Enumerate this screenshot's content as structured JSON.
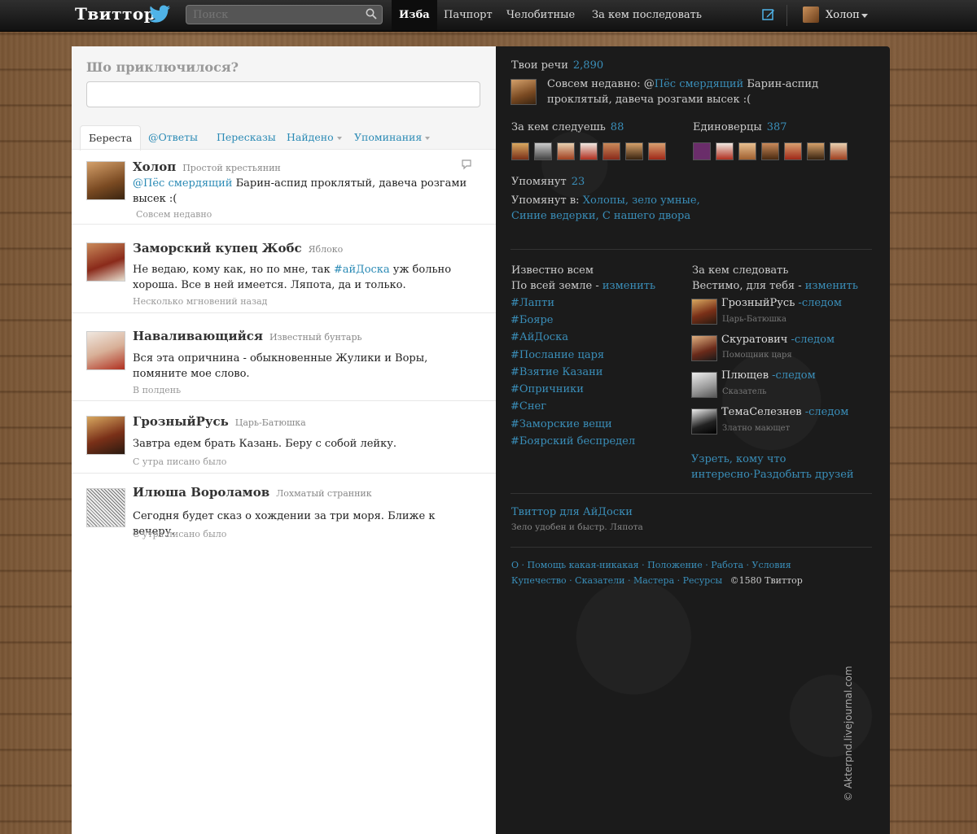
{
  "topbar": {
    "logo": "Твиттор",
    "search_placeholder": "Поиск",
    "nav": [
      "Изба",
      "Пачпорт",
      "Челобитные",
      "За кем последовать"
    ],
    "user": "Холоп"
  },
  "compose": {
    "title": "Шо приключилося?"
  },
  "tabs": [
    "Береста",
    "@Ответы",
    "Пересказы",
    "Найдено",
    "Упоминания"
  ],
  "tweets": [
    {
      "name": "Холоп",
      "handle": "Простой крестьянин",
      "mention": "@Пёс смердящий",
      "text": " Барин-аспид проклятый, давеча розгами высек :(",
      "time": "Совсем недавно"
    },
    {
      "name": "Заморский купец Жобс",
      "handle": "Яблоко",
      "text_before": "Не ведаю, кому как, но по мне, так ",
      "hashtag": "#айДоска",
      "text_after": " уж больно хороша. Все в ней имеется. Ляпота, да и только.",
      "time": "Несколько мгновений назад"
    },
    {
      "name": "Наваливающийся",
      "handle": "Известный бунтарь",
      "text": "Вся эта опричнина - обыкновенные Жулики и Воры, помяните мое слово.",
      "time": "В полдень"
    },
    {
      "name": "ГрозныйРусь",
      "handle": "Царь-Батюшка",
      "text": "Завтра едем брать Казань. Беру с собой лейку.",
      "time": "С утра писано было"
    },
    {
      "name": "Илюша Вороламов",
      "handle": "Лохматый странник",
      "text": "Сегодня будет сказ о хождении за три моря. Ближе к вечеру.",
      "time": "С утра писано было"
    }
  ],
  "sidebar": {
    "speeches_label": "Твои речи",
    "speeches_count": "2,890",
    "latest_prefix": "Совсем недавно: @",
    "latest_mention": "Пёс смердящий",
    "latest_text": " Барин-аспид проклятый, давеча розгами высек :(",
    "following_label": "За кем следуешь",
    "following_count": "88",
    "followers_label": "Единоверцы",
    "followers_count": "387",
    "mentioned_label": "Упомянут",
    "mentioned_count": "23",
    "mentioned_in_label": "Упомянут в:",
    "mentioned_in_1": "Холопы, зело умные,",
    "mentioned_in_2": "Синие ведерки, С нашего двора",
    "trends_title": "Известно всем",
    "trends_sub": "По всей земле - ",
    "trends_change": "изменить",
    "trends": [
      "#Лапти",
      "#Бояре",
      "#АйДоска",
      "#Послание царя",
      "#Взятие Казани",
      "#Опричники",
      "#Снег",
      "#Заморские вещи",
      "#Боярский беспредел"
    ],
    "who_title": "За кем следовать",
    "who_sub": "Вестимо, для тебя - ",
    "who_change": "изменить",
    "suggestions": [
      {
        "name": "ГрозныйРусь",
        "follow": "-следом",
        "sub": "Царь-Батюшка"
      },
      {
        "name": "Скуратович",
        "follow": "-следом",
        "sub": "Помощник царя"
      },
      {
        "name": "Плющев",
        "follow": "-следом",
        "sub": "Сказатель"
      },
      {
        "name": "ТемаСелезнев",
        "follow": "-следом",
        "sub": "Златно мающет"
      }
    ],
    "browse_1": "Узреть, кому что",
    "browse_2": "интересно",
    "browse_3": "·Раздобыть друзей",
    "app_link": "Твиттор для АйДоски",
    "app_sub": "Зело удобен и быстр. Ляпота",
    "footer_1": "О · Помощь какая-никакая · Положение · Работа · Условия",
    "footer_2": "Купечество · Сказатели · Мастера · Ресурсы",
    "copyright": "©1580 Твиттор"
  },
  "watermark": "© Akterpnd.livejournal.com",
  "colors": {
    "link": "#2a8ab5",
    "topbar": "#1a1a1a",
    "sidebar_bg": "#1b1b1b"
  }
}
